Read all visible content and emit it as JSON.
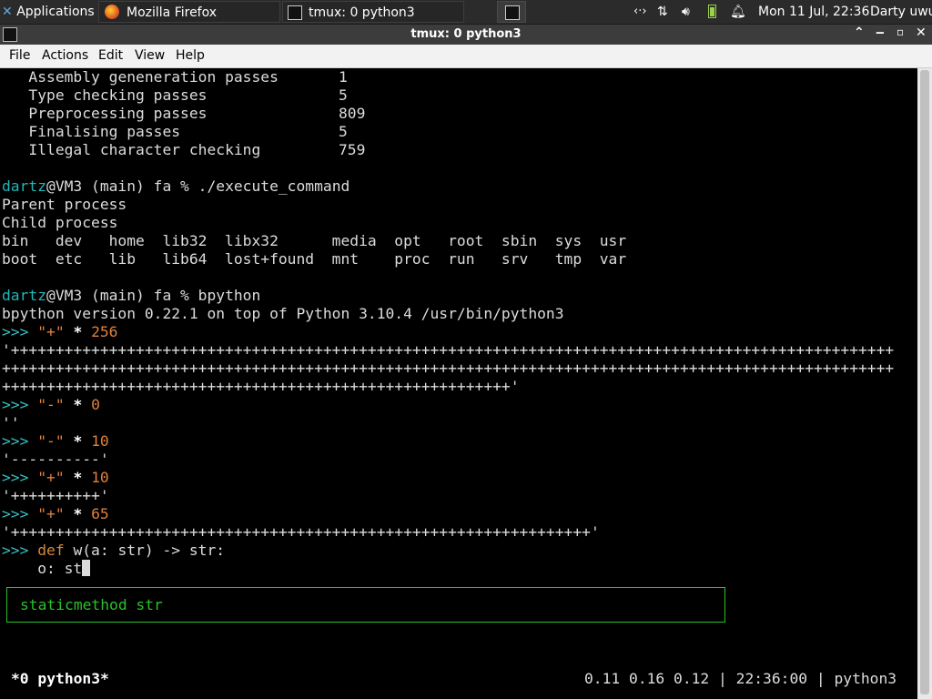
{
  "taskbar": {
    "applications": "Applications",
    "tasks": [
      "Mozilla Firefox",
      "tmux: 0 python3"
    ],
    "clock": "Mon 11 Jul, 22:36",
    "user": "Darty uwu"
  },
  "window": {
    "title": "tmux: 0 python3"
  },
  "menu": [
    "File",
    "Actions",
    "Edit",
    "View",
    "Help"
  ],
  "terminal": {
    "stats": [
      {
        "label": "Assembly geneneration passes",
        "value": "1"
      },
      {
        "label": "Type checking passes",
        "value": "5"
      },
      {
        "label": "Preprocessing passes",
        "value": "809"
      },
      {
        "label": "Finalising passes",
        "value": "5"
      },
      {
        "label": "Illegal character checking",
        "value": "759"
      }
    ],
    "prompt_user": "dartz",
    "prompt_host": "@VM3 (main) fa % ",
    "cmd1": "./execute_command",
    "parent": "Parent process",
    "child": "Child process",
    "ls_row1": "bin   dev   home  lib32  libx32      media  opt   root  sbin  sys  usr",
    "ls_row2": "boot  etc   lib   lib64  lost+found  mnt    proc  run   srv   tmp  var",
    "cmd2": "bpython",
    "version": "bpython version 0.22.1 on top of Python 3.10.4 /usr/bin/python3",
    "prompt_py": ">>> ",
    "plus256_1": "'+++++++++++++++++++++++++++++++++++++++++++++++++++++++++++++++++++++++++++++++++++++++++++++++++++",
    "plus256_2": "++++++++++++++++++++++++++++++++++++++++++++++++++++++++++++++++++++++++++++++++++++++++++++++++++++",
    "plus256_3": "+++++++++++++++++++++++++++++++++++++++++++++++++++++++++'",
    "empty": "''",
    "dash10": "'----------'",
    "plus10": "'++++++++++'",
    "plus65": "'+++++++++++++++++++++++++++++++++++++++++++++++++++++++++++++++++'",
    "def_kw": "def",
    "def_rest": " w(a: str) -> str:",
    "body": "    o: st",
    "completion": "staticmethod str"
  },
  "status": {
    "left": "*0 python3*",
    "right": "0.11 0.16 0.12 | 22:36:00 | python3"
  }
}
